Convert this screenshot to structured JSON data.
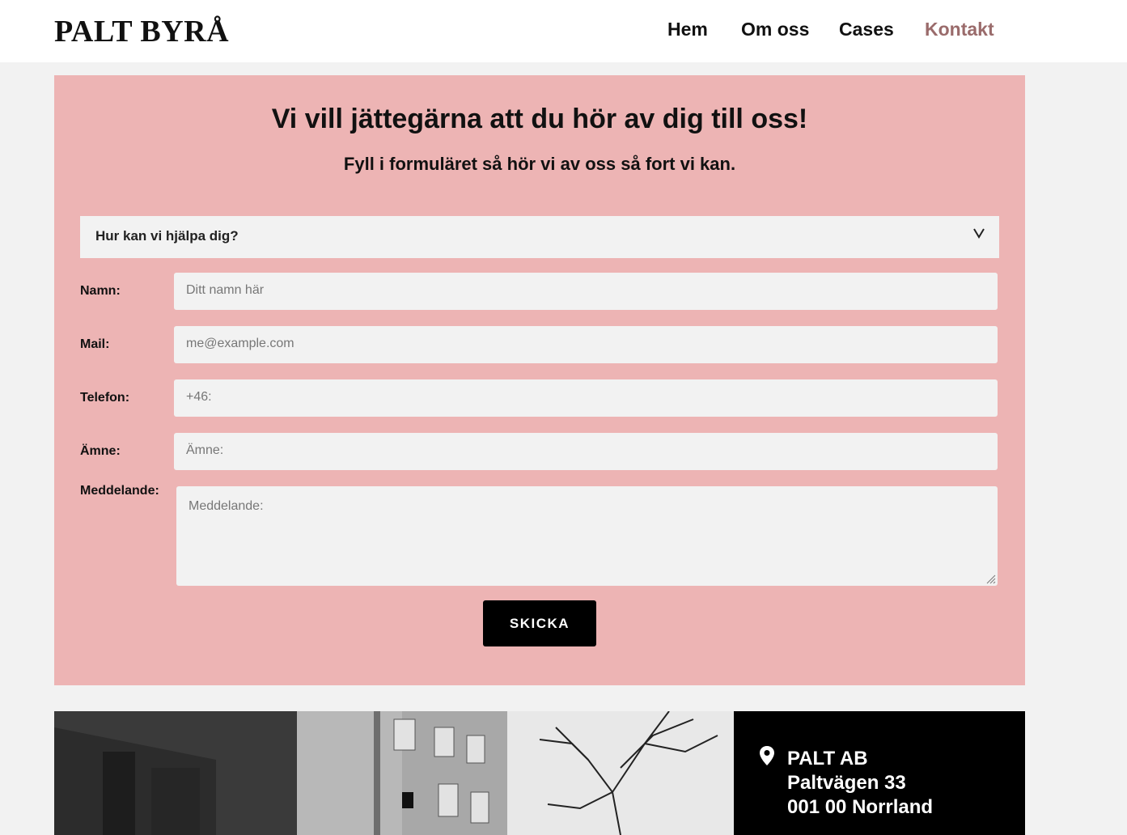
{
  "header": {
    "logo": "PALT BYRÅ",
    "nav": [
      {
        "label": "Hem",
        "active": false
      },
      {
        "label": "Om oss",
        "active": false
      },
      {
        "label": "Cases",
        "active": false
      },
      {
        "label": "Kontakt",
        "active": true
      }
    ],
    "active_color": "#9a6b6b"
  },
  "contact": {
    "heading": "Vi vill jättegärna att du hör av dig till oss!",
    "subheading": "Fyll i formuläret så hör vi av oss så fort vi kan.",
    "card_color": "#edb4b4",
    "help_select": {
      "value": "Hur kan vi hjälpa dig?",
      "icon": "chevron-down-icon"
    },
    "fields": [
      {
        "label": "Namn:",
        "placeholder": "Ditt namn här"
      },
      {
        "label": "Mail:",
        "placeholder": "me@example.com"
      },
      {
        "label": "Telefon:",
        "placeholder": "+46:"
      },
      {
        "label": "Ämne:",
        "placeholder": "Ämne:"
      }
    ],
    "message": {
      "label": "Meddelande:",
      "placeholder": "Meddelande:"
    },
    "submit_label": "SKICKA"
  },
  "address": {
    "icon": "map-pin-icon",
    "lines": [
      "PALT AB",
      "Paltvägen 33",
      "001 00 Norrland"
    ]
  }
}
